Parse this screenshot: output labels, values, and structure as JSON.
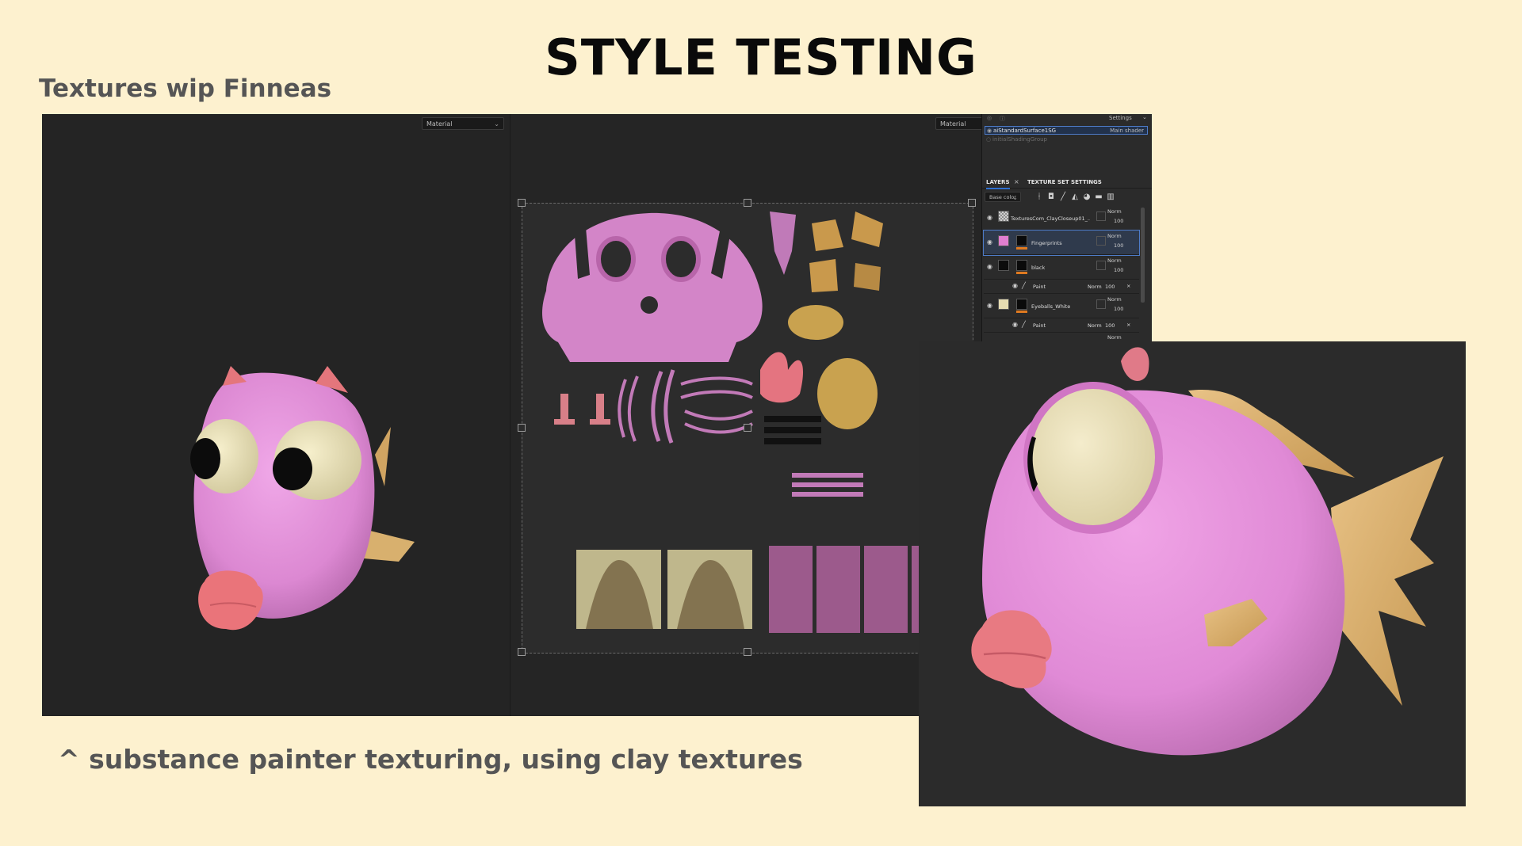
{
  "slide": {
    "title": "STYLE TESTING",
    "subtitle": "Textures wip Finneas",
    "caption": "^ substance painter texturing, using clay textures"
  },
  "app": {
    "viewport_3d": {
      "material_dropdown": "Material"
    },
    "viewport_2d": {
      "material_dropdown": "Material"
    },
    "panel": {
      "settings_label": "Settings",
      "shaders": [
        {
          "name": "aiStandardSurface1SG",
          "role": "Main shader",
          "selected": true
        },
        {
          "name": "initialShadingGroup",
          "role": "",
          "selected": false
        }
      ],
      "tabs": [
        {
          "label": "LAYERS",
          "active": true
        },
        {
          "label": "TEXTURE SET SETTINGS",
          "active": false
        }
      ],
      "channel_dropdown": "Base color",
      "layers": [
        {
          "name": "TexturesCom_ClayCloseup01_...",
          "blend": "Norm",
          "opacity": "100",
          "thumb_color": "#d9d6cf",
          "selected": false
        },
        {
          "name": "Fingerprints",
          "blend": "Norm",
          "opacity": "100",
          "thumb_color": "#e07ed0",
          "selected": true
        },
        {
          "name": "black",
          "blend": "Norm",
          "opacity": "100",
          "thumb_color": "#0c0c0c",
          "selected": false
        },
        {
          "name": "Eyeballs_White",
          "blend": "Norm",
          "opacity": "100",
          "thumb_color": "#e6dcb2",
          "selected": false
        }
      ],
      "sublayers": [
        {
          "name": "Paint",
          "blend": "Norm",
          "opacity": "100"
        },
        {
          "name": "Paint",
          "blend": "Norm",
          "opacity": "100"
        }
      ],
      "last_layer_blend": "Norm"
    }
  },
  "colors": {
    "background": "#fdf1cf",
    "clay_pink": "#e08ad6",
    "lip_coral": "#e8737a",
    "fin_tan": "#d8b06e",
    "eye_cream": "#ece4bc",
    "accent_blue": "#2e6fd0"
  }
}
